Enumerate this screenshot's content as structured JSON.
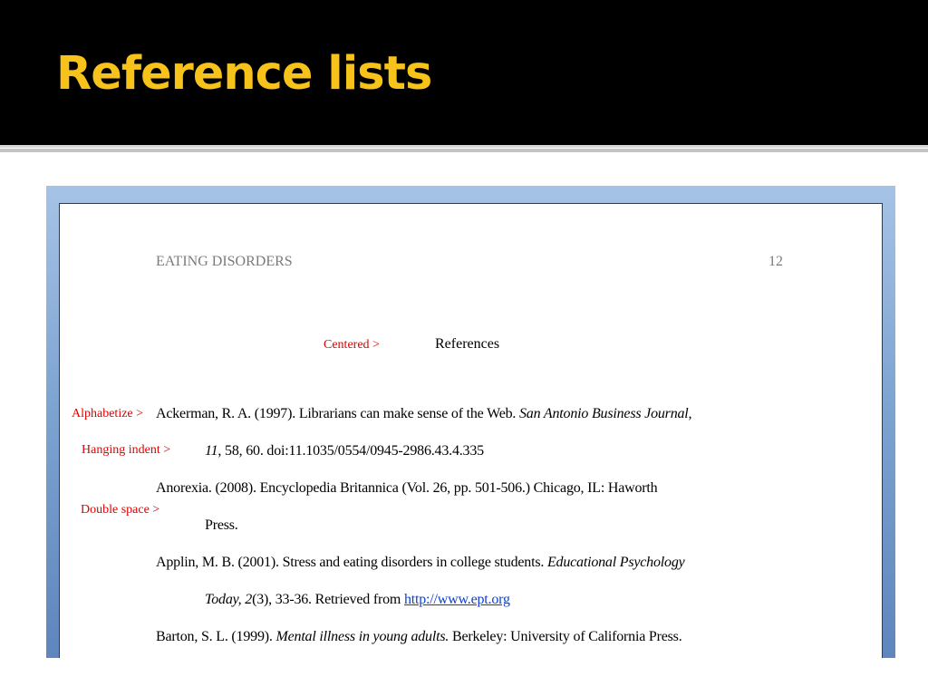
{
  "slide": {
    "title": "Reference lists"
  },
  "document": {
    "running_head": "EATING DISORDERS",
    "page_number": "12",
    "heading": "References"
  },
  "annotations": {
    "centered": "Centered  >",
    "alphabetize": "Alphabetize >",
    "hanging_indent": "Hanging indent  >",
    "double_space": "Double space >"
  },
  "references": {
    "r1_l1_plain": "Ackerman, R. A. (1997).  Librarians can make sense of the Web.  ",
    "r1_l1_italic": "San Antonio Business Journal,",
    "r1_l2_italic": "11",
    "r1_l2_plain": ", 58, 60.  doi:11.1035/0554/0945-2986.43.4.335",
    "r2_l1": "Anorexia.  (2008).  Encyclopedia Britannica (Vol. 26, pp. 501-506.)  Chicago, IL:  Haworth",
    "r2_l2": "Press.",
    "r3_l1_plain": "Applin, M. B. (2001).  Stress and eating disorders in college students.  ",
    "r3_l1_italic": "Educational Psychology",
    "r3_l2_italic": "Today, 2",
    "r3_l2_plain": "(3), 33-36.  Retrieved from ",
    "r3_l2_link": "http://www.ept.org",
    "r4_plain_a": "Barton, S. L.  (1999).  ",
    "r4_italic": "Mental illness in young adults.",
    "r4_plain_b": "  Berkeley:  University of California Press."
  },
  "colors": {
    "title": "#f7c31b",
    "title_bar": "#000000",
    "annotation": "#e00000",
    "link": "#0b3fcf"
  }
}
